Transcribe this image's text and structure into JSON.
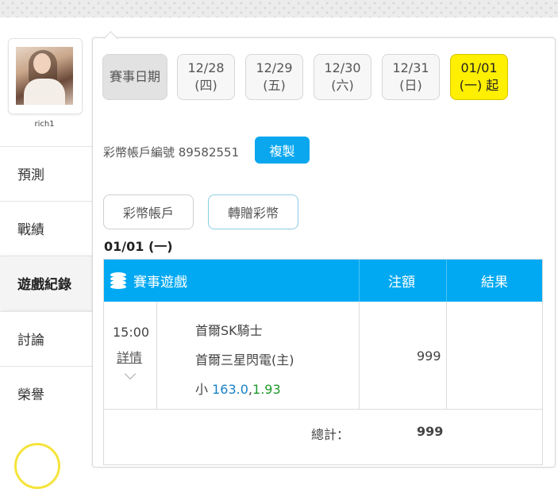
{
  "user": {
    "name": "rich1"
  },
  "menu": [
    {
      "label": "預測"
    },
    {
      "label": "戰績"
    },
    {
      "label": "遊戲紀錄"
    },
    {
      "label": "討論"
    },
    {
      "label": "榮譽"
    }
  ],
  "dates": {
    "label": "賽事日期",
    "items": [
      {
        "date": "12/28",
        "weekday": "(四)"
      },
      {
        "date": "12/29",
        "weekday": "(五)"
      },
      {
        "date": "12/30",
        "weekday": "(六)"
      },
      {
        "date": "12/31",
        "weekday": "(日)"
      },
      {
        "date": "01/01",
        "weekday": "(一) 起"
      }
    ]
  },
  "account": {
    "label": "彩幣帳戶編號 89582551",
    "copy_label": "複製"
  },
  "tabs": {
    "account": "彩幣帳戶",
    "transfer": "轉贈彩幣"
  },
  "day_heading": "01/01 (一)",
  "table": {
    "col_game": "賽事遊戲",
    "col_amount": "注額",
    "col_result": "結果",
    "row": {
      "time": "15:00",
      "details": "詳情",
      "team1": "首爾SK騎士",
      "team2": "首爾三星閃電(主)",
      "bet_prefix": "小",
      "bet_line": "163.0",
      "bet_sep": ",",
      "bet_odds": "1.93",
      "amount": "999",
      "result": ""
    },
    "total_label": "總計：",
    "total_value": "999"
  },
  "colors": {
    "accent": "#00a9f2",
    "selected_date": "#ffef00",
    "copy_button": "#0aa7ef"
  }
}
